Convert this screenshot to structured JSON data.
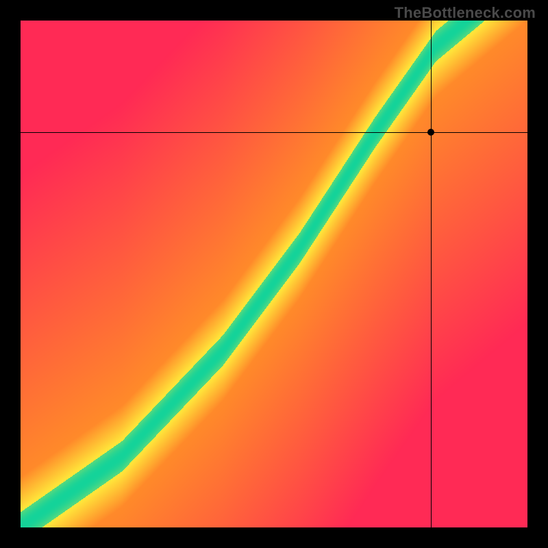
{
  "watermark": "TheBottleneck.com",
  "chart_data": {
    "type": "heatmap",
    "title": "",
    "xlabel": "",
    "ylabel": "",
    "xlim": [
      0,
      100
    ],
    "ylim": [
      0,
      100
    ],
    "grid": false,
    "note": "Color encodes closeness to the optimal ridge. Green = on-ridge (best), yellow = near, red = far. The ridge is an approximately diagonal curve with slight S-shape. Values are modeled as distance from ridge; exact per-pixel source data is not labeled, axes are unitless 0–100.",
    "ridge_control_points": [
      {
        "x": 0,
        "y": 0
      },
      {
        "x": 20,
        "y": 14
      },
      {
        "x": 40,
        "y": 35
      },
      {
        "x": 55,
        "y": 55
      },
      {
        "x": 70,
        "y": 78
      },
      {
        "x": 82,
        "y": 95
      },
      {
        "x": 100,
        "y": 110
      }
    ],
    "ridge_width_green": 3.0,
    "ridge_width_yellow": 10.0,
    "marker": {
      "x": 81,
      "y": 78
    },
    "crosshair": {
      "x": 81,
      "y": 78
    },
    "colors": {
      "green": "#14d39a",
      "yellow": "#ffe93b",
      "orange": "#ff8a2a",
      "red": "#ff2a55"
    }
  }
}
